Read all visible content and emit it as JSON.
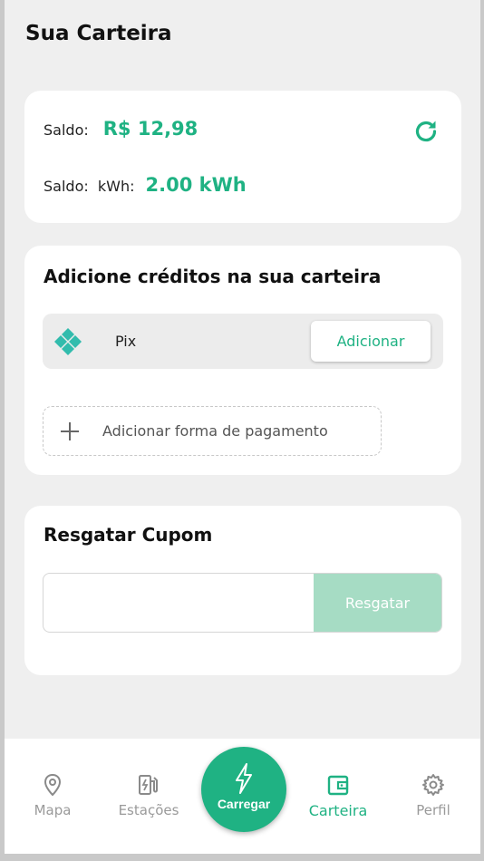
{
  "header": {
    "title": "Sua Carteira"
  },
  "balance": {
    "label_money": "Saldo:",
    "value_money": "R$ 12,98",
    "label_kwh": "Saldo:  kWh:",
    "value_kwh": "2.00 kWh",
    "refresh_icon": "refresh-icon"
  },
  "credits": {
    "title": "Adicione créditos na sua carteira",
    "methods": [
      {
        "icon": "pix-icon",
        "label": "Pix",
        "button": "Adicionar"
      }
    ],
    "add_method_label": "Adicionar forma de pagamento"
  },
  "coupon": {
    "title": "Resgatar Cupom",
    "input_value": "",
    "input_placeholder": "",
    "button": "Resgatar"
  },
  "nav": {
    "items": [
      {
        "icon": "map-pin-icon",
        "label": "Mapa"
      },
      {
        "icon": "charging-station-icon",
        "label": "Estações"
      },
      {
        "icon": "bolt-icon",
        "label": "Carregar"
      },
      {
        "icon": "wallet-icon",
        "label": "Carteira",
        "active": true
      },
      {
        "icon": "gear-icon",
        "label": "Perfil"
      }
    ]
  },
  "colors": {
    "accent": "#1fb283",
    "accent_light": "#a6dcc4",
    "background": "#efefef",
    "card": "#ffffff"
  }
}
